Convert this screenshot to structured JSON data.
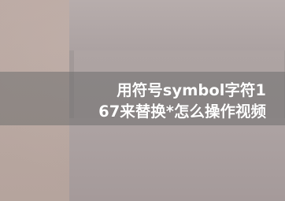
{
  "caption": {
    "text": "用符号symbol字符1\n67来替换*怎么操作视频"
  }
}
